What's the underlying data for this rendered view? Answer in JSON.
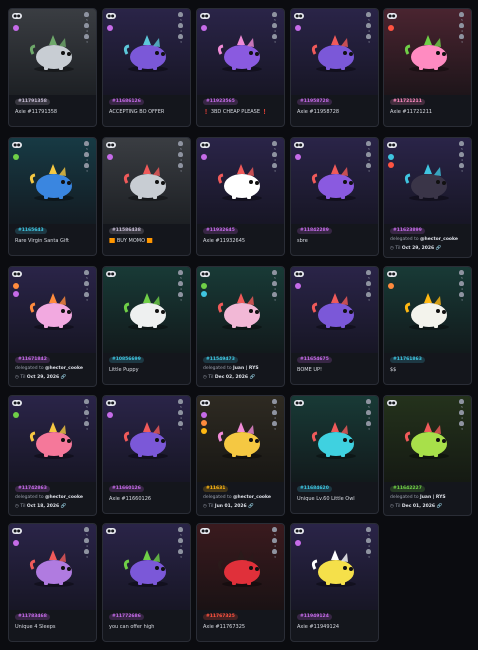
{
  "stat_labels": [
    "5",
    "4",
    "3"
  ],
  "colors": {
    "Aquatic": "#3fc5e0",
    "Plant": "#6fcf47",
    "Reptile": "#c56be8",
    "Bird": "#ff8bc1",
    "Beast": "#ffb812",
    "Bug": "#ff5341",
    "Mech": "#c6bcd4",
    "Dusk": "#129092"
  },
  "cards": [
    {
      "id": "#11791358",
      "name": "Axie #11791358",
      "cls": "Mech",
      "bg": [
        "#3a3d42",
        "#1d2024"
      ],
      "body": "#c8cdd3",
      "accent": "#6ea86a",
      "dots": [
        "#c56be8"
      ]
    },
    {
      "id": "#11686126",
      "name": "ACCEPTING BO OFFER",
      "cls": "Reptile",
      "bg": [
        "#2a2448",
        "#171625"
      ],
      "body": "#7b58d8",
      "accent": "#5cc7d9",
      "dots": [
        "#c56be8"
      ]
    },
    {
      "id": "#11923565",
      "name": "❗ 3BD CHEAP PLEASE ❗",
      "cls": "Reptile",
      "bg": [
        "#2a2448",
        "#171625"
      ],
      "body": "#8a5ae0",
      "accent": "#f08bd7",
      "dots": [
        "#c56be8"
      ]
    },
    {
      "id": "#11958728",
      "name": "Axie #11958728",
      "cls": "Reptile",
      "bg": [
        "#2a2448",
        "#171625"
      ],
      "body": "#7b58d8",
      "accent": "#f05a5a",
      "dots": [
        "#c56be8"
      ]
    },
    {
      "id": "#11721211",
      "name": "Axie #11721211",
      "cls": "Bird",
      "bg": [
        "#4a2430",
        "#1e151a"
      ],
      "body": "#ff8bc1",
      "accent": "#6fcf47",
      "dots": [
        "#ff5341"
      ]
    },
    {
      "id": "#1165643",
      "name": "Rare Virgin Santa Gift",
      "cls": "Aquatic",
      "bg": [
        "#173a44",
        "#131b22"
      ],
      "body": "#3a86e0",
      "accent": "#f5c842",
      "dots": [
        "#6fcf47"
      ]
    },
    {
      "id": "#11586438",
      "name": "🟧 BUY MOMO 🟧",
      "cls": "Mech",
      "bg": [
        "#3a3d42",
        "#1d2024"
      ],
      "body": "#c8cdd3",
      "accent": "#f05a5a",
      "dots": [
        "#c56be8"
      ]
    },
    {
      "id": "#11932645",
      "name": "Axie #11932645",
      "cls": "Reptile",
      "bg": [
        "#2a2448",
        "#171625"
      ],
      "body": "#ffffff",
      "accent": "#f05a5a",
      "dots": [
        "#c56be8"
      ]
    },
    {
      "id": "#11842289",
      "name": "sbre",
      "cls": "Reptile",
      "bg": [
        "#2a2448",
        "#171625"
      ],
      "body": "#8a5ae0",
      "accent": "#f05a5a",
      "dots": [
        "#c56be8"
      ]
    },
    {
      "id": "#11623899",
      "name": "",
      "delegated": "delegated to",
      "to": "@hector_cooke",
      "until_pre": "Til",
      "until": "Oct 29, 2026",
      "cls": "Reptile",
      "bg": [
        "#2a2448",
        "#171625"
      ],
      "body": "#3a3548",
      "accent": "#3fc5e0",
      "dots": [
        "#3fc5e0",
        "#ff5341"
      ]
    },
    {
      "id": "#11671842",
      "name": "",
      "delegated": "delegated to",
      "to": "@hector_cooke",
      "until_pre": "Til",
      "until": "Oct 29, 2026",
      "cls": "Reptile",
      "bg": [
        "#2a2448",
        "#171625"
      ],
      "body": "#f2a9e0",
      "accent": "#ff8b3d",
      "dots": [
        "#ff8b3d",
        "#c56be8"
      ]
    },
    {
      "id": "#10856699",
      "name": "Little Puppy",
      "cls": "Aquatic",
      "bg": [
        "#183a36",
        "#121a1c"
      ],
      "body": "#eef0f0",
      "accent": "#6fcf47",
      "dots": []
    },
    {
      "id": "#11549473",
      "name": "",
      "delegated": "delegated to",
      "to": "Juan | RYS",
      "until_pre": "Til",
      "until": "Dec 02, 2026",
      "cls": "Aquatic",
      "bg": [
        "#183a36",
        "#121a1c"
      ],
      "body": "#f2b8d6",
      "accent": "#f05a5a",
      "dots": [
        "#6fcf47",
        "#3fc5e0"
      ]
    },
    {
      "id": "#11654675",
      "name": "BOME UP!",
      "cls": "Reptile",
      "bg": [
        "#2a2448",
        "#171625"
      ],
      "body": "#7b58d8",
      "accent": "#f05a5a",
      "dots": [
        "#c56be8"
      ]
    },
    {
      "id": "#11761863",
      "name": "$$",
      "cls": "Aquatic",
      "bg": [
        "#183a36",
        "#121a1c"
      ],
      "body": "#f3f3ec",
      "accent": "#ffb812",
      "dots": [
        "#ff8b3d"
      ]
    },
    {
      "id": "#11742863",
      "name": "",
      "delegated": "delegated to",
      "to": "@hector_cooke",
      "until_pre": "Til",
      "until": "Oct 18, 2026",
      "cls": "Reptile",
      "bg": [
        "#2a2448",
        "#171625"
      ],
      "body": "#f5789a",
      "accent": "#f5c842",
      "dots": [
        "#6fcf47"
      ]
    },
    {
      "id": "#11660126",
      "name": "Axie #11660126",
      "cls": "Reptile",
      "bg": [
        "#2a2448",
        "#171625"
      ],
      "body": "#7b58d8",
      "accent": "#f05a5a",
      "dots": [
        "#c56be8"
      ]
    },
    {
      "id": "#11631",
      "name": "",
      "delegated": "delegated to",
      "to": "@hector_cooke",
      "until_pre": "Til",
      "until": "Jun 01, 2026",
      "cls": "Beast",
      "bg": [
        "#2e2a22",
        "#181714"
      ],
      "body": "#f5c842",
      "accent": "#f08bd7",
      "dots": [
        "#c56be8",
        "#ff8b3d",
        "#ffb812"
      ]
    },
    {
      "id": "#11684620",
      "name": "Unique Lv.60 Little Owl",
      "cls": "Aquatic",
      "bg": [
        "#183a36",
        "#121a1c"
      ],
      "body": "#3fd1e0",
      "accent": "#f05a5a",
      "dots": []
    },
    {
      "id": "#11642227",
      "name": "",
      "delegated": "delegated to",
      "to": "Juan | RYS",
      "until_pre": "Til",
      "until": "Dec 01, 2026",
      "cls": "Plant",
      "bg": [
        "#24321c",
        "#151a13"
      ],
      "body": "#a8e04a",
      "accent": "#f05a5a",
      "dots": []
    },
    {
      "id": "#11783468",
      "name": "Unique 4 Sleeps",
      "cls": "Reptile",
      "bg": [
        "#2a2448",
        "#171625"
      ],
      "body": "#b07be0",
      "accent": "#f05a5a",
      "dots": [
        "#c56be8"
      ]
    },
    {
      "id": "#11772686",
      "name": "you can offer high",
      "cls": "Reptile",
      "bg": [
        "#2a2448",
        "#171625"
      ],
      "body": "#7b58d8",
      "accent": "#6fcf47",
      "dots": []
    },
    {
      "id": "#11767325",
      "name": "Axie #11767325",
      "cls": "Bug",
      "bg": [
        "#3a1a1e",
        "#1a1214"
      ],
      "body": "#e0303a",
      "accent": "#2a1a1a",
      "dots": []
    },
    {
      "id": "#11949124",
      "name": "Axie #11949124",
      "cls": "Reptile",
      "bg": [
        "#2a2448",
        "#171625"
      ],
      "body": "#f5e04a",
      "accent": "#ffffff",
      "dots": [
        "#c56be8"
      ]
    }
  ]
}
